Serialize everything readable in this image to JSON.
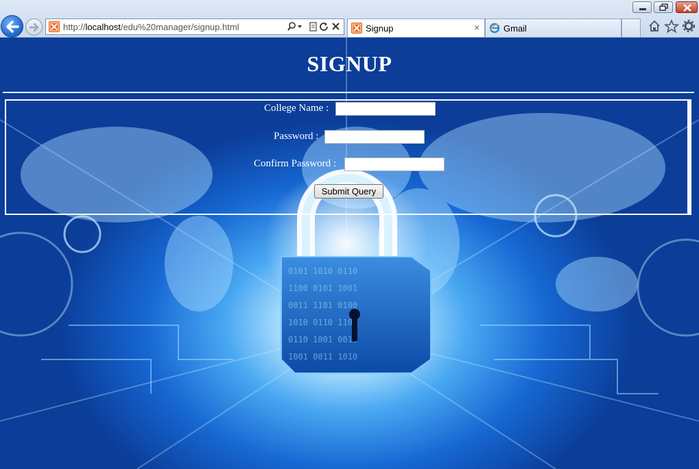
{
  "browser": {
    "address_url_prefix": "http://",
    "address_url_host": "localhost",
    "address_url_path": "/edu%20manager/signup.html",
    "tabs": [
      {
        "label": "Signup",
        "active": true
      },
      {
        "label": "Gmail",
        "active": false
      }
    ],
    "tab_close_glyph": "×",
    "window_controls": [
      "minimize-icon",
      "restore-icon",
      "close-icon"
    ],
    "toolbar_icons": [
      "home-icon",
      "favorites-star-icon",
      "settings-gear-icon"
    ],
    "address_icons": [
      "search-icon",
      "dropdown-icon",
      "compatibility-view-icon",
      "refresh-icon",
      "stop-icon"
    ]
  },
  "page": {
    "title": "SIGNUP",
    "form": {
      "college_label": "College Name :",
      "college_value": "",
      "password_label": "Password :",
      "password_value": "",
      "confirm_label": "Confirm Password :",
      "confirm_value": "",
      "submit_label": "Submit Query"
    }
  },
  "colors": {
    "page_text": "#ffffff",
    "bg_deep_blue": "#0b3d99",
    "bg_glow": "#bfeaff",
    "favicon_orange": "#e8631a"
  }
}
